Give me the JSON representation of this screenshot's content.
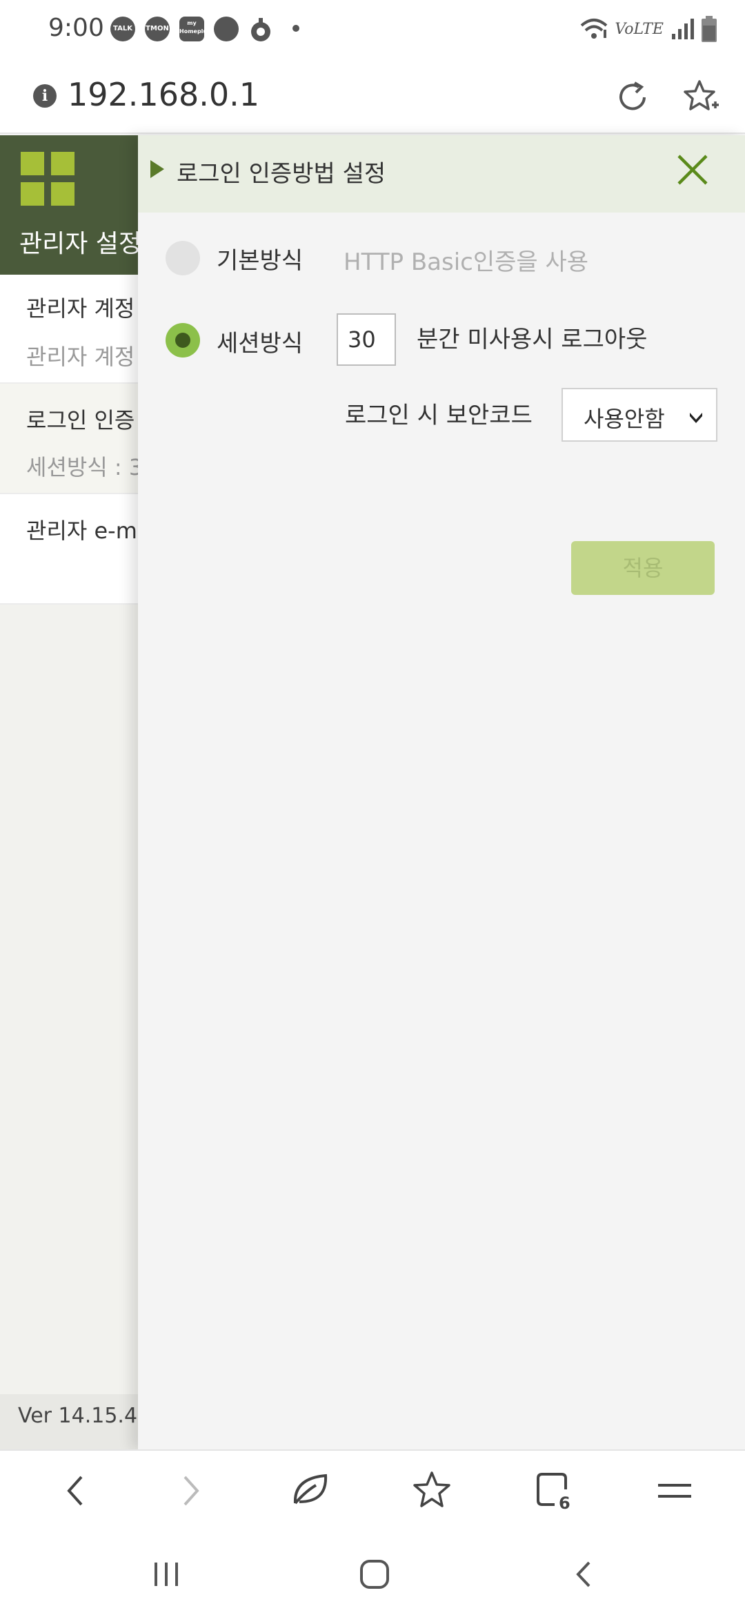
{
  "status_bar": {
    "time": "9:00",
    "notifications": [
      "TALK",
      "TMON",
      "my Homeplus"
    ],
    "network": "VoLTE"
  },
  "url_bar": {
    "url": "192.168.0.1"
  },
  "background_page": {
    "title": "관리자 설정",
    "items": [
      {
        "title": "관리자 계정",
        "subtitle": "관리자 계정"
      },
      {
        "title": "로그인 인증",
        "subtitle": "세션방식 : 3"
      },
      {
        "title": "관리자 e-m",
        "subtitle": ""
      }
    ],
    "version": "Ver 14.15.4"
  },
  "panel": {
    "title": "로그인 인증방법 설정",
    "options": [
      {
        "label": "기본방식",
        "description": "HTTP Basic인증을 사용",
        "selected": false
      },
      {
        "label": "세션방식",
        "selected": true
      }
    ],
    "session_minutes": "30",
    "session_minutes_suffix": "분간 미사용시 로그아웃",
    "security_code_label": "로그인 시 보안코드",
    "security_code_value": "사용안함",
    "apply_label": "적용"
  },
  "toolbar": {
    "tab_count": "6"
  },
  "colors": {
    "header_dark": "#4a5a3a",
    "accent_green": "#8cc04a",
    "button_disabled": "#c2d68a",
    "close_green": "#5a8a1a"
  }
}
